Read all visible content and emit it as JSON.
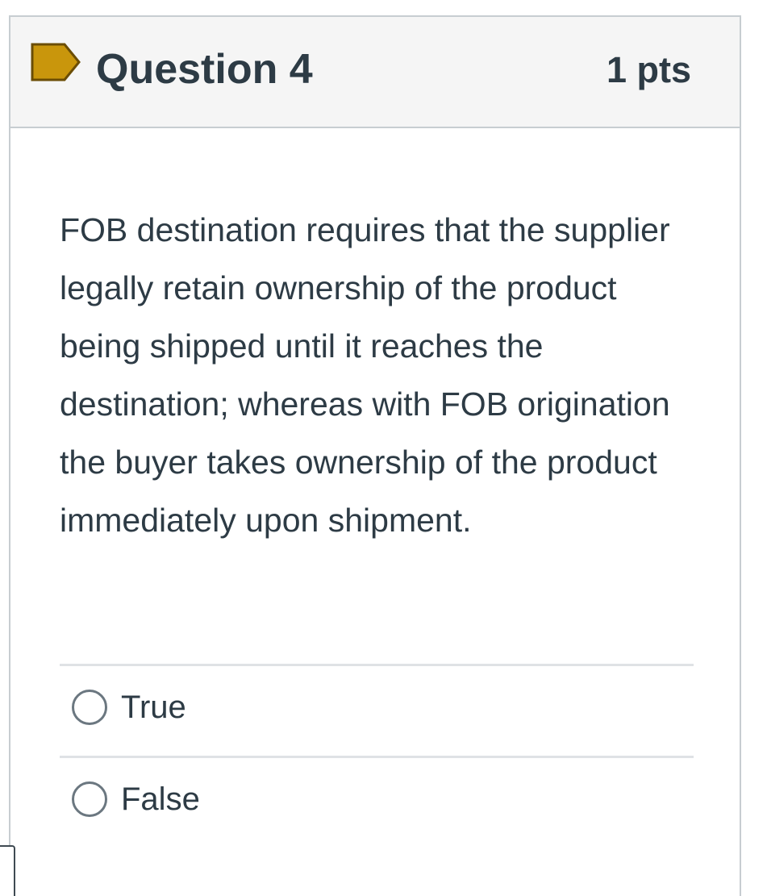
{
  "question": {
    "title": "Question 4",
    "points": "1 pts",
    "flag_icon": "bookmark-flag-icon",
    "flag_color": "#c9960c",
    "text": "FOB destination requires that the supplier legally retain ownership of the product being shipped until it reaches the destination; whereas with FOB origination the buyer takes ownership of the product immediately upon shipment.",
    "answers": [
      {
        "label": "True"
      },
      {
        "label": "False"
      }
    ]
  }
}
